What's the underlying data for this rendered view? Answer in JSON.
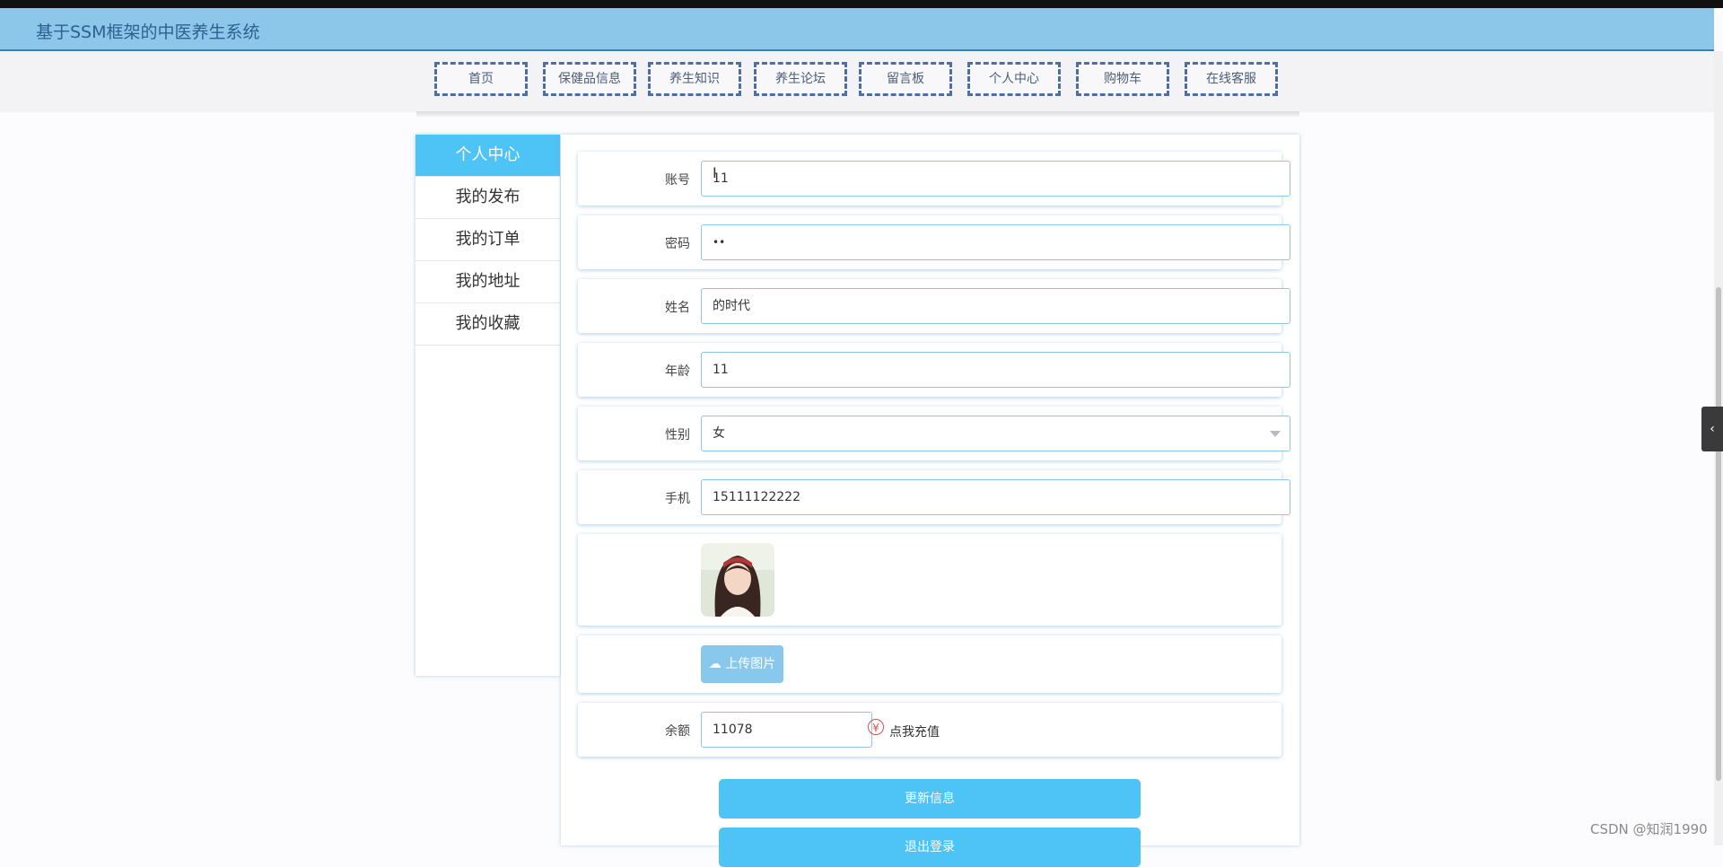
{
  "app": {
    "title": "基于SSM框架的中医养生系统"
  },
  "nav": {
    "items": [
      "首页",
      "保健品信息",
      "养生知识",
      "养生论坛",
      "留言板",
      "个人中心",
      "购物车",
      "在线客服"
    ]
  },
  "sidebar": {
    "items": [
      "个人中心",
      "我的发布",
      "我的订单",
      "我的地址",
      "我的收藏"
    ],
    "active_index": 0
  },
  "form": {
    "account": {
      "label": "账号",
      "value": "11"
    },
    "password": {
      "label": "密码",
      "value": "••"
    },
    "name": {
      "label": "姓名",
      "value": "的时代"
    },
    "age": {
      "label": "年龄",
      "value": "11"
    },
    "gender": {
      "label": "性别",
      "value": "女"
    },
    "phone": {
      "label": "手机",
      "value": "15111122222"
    },
    "upload_label": "上传图片",
    "balance": {
      "label": "余额",
      "value": "11078"
    },
    "recharge_label": "点我充值",
    "recharge_icon": "¥"
  },
  "buttons": {
    "update": "更新信息",
    "logout": "退出登录"
  },
  "watermark": "CSDN @知润1990",
  "colors": {
    "header": "#8cc7ea",
    "accent": "#4ec3f6",
    "nav_border": "#4e6fa6"
  }
}
